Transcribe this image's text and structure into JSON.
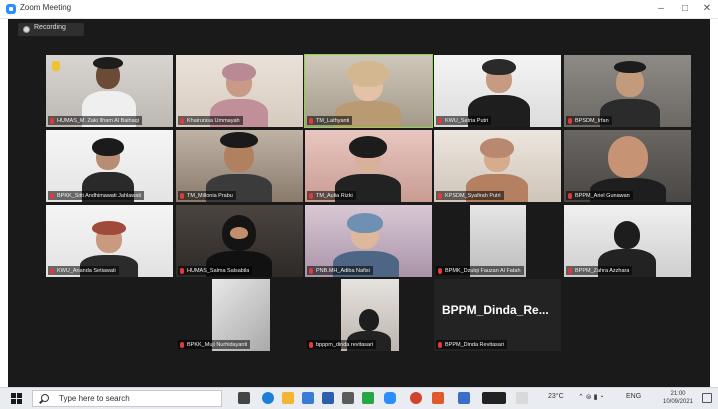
{
  "window": {
    "title": "Zoom Meeting",
    "controls": [
      "–",
      "□",
      "✕"
    ]
  },
  "recording": {
    "label": "Recording"
  },
  "tiles": [
    {
      "name": "HUMAS_M. Zaki Ilham Al Baihaqi",
      "active": false
    },
    {
      "name": "Khairunisa Ummayah",
      "active": false
    },
    {
      "name": "TM_Lathyanti",
      "active": true
    },
    {
      "name": "KWU_Satria Putri",
      "active": false
    },
    {
      "name": "BPSDM_Irfan",
      "active": false
    },
    {
      "name": "BPKK_Sitti Andhimawati Jahlawati",
      "active": false
    },
    {
      "name": "TM_Millonia Prabu",
      "active": false
    },
    {
      "name": "TM_Aulia Rizki",
      "active": false
    },
    {
      "name": "KPSDM_Syafirah Putri",
      "active": false
    },
    {
      "name": "BPPM_Ariel Gunawan",
      "active": false
    },
    {
      "name": "KWU_Ananda Setiawati",
      "active": false
    },
    {
      "name": "HUMAS_Salma Salsabila",
      "active": false
    },
    {
      "name": "PNB.MH_Adiba Nafisi",
      "active": false
    },
    {
      "name": "BPMK_Dzulqi Fauzan Al Fatah",
      "active": false
    },
    {
      "name": "BPPM_Zahra Azzhara",
      "active": false
    },
    {
      "name": "BPKK_Muji Nurhidayanti",
      "active": false
    },
    {
      "name": "bpppm_dinda revitasari",
      "active": false
    },
    {
      "name": "BPPM_Dinda Revitasari",
      "active": false,
      "display_text": "BPPM_Dinda_Re..."
    }
  ],
  "taskbar": {
    "search_placeholder": "Type here to search",
    "tray_temp": "23°C",
    "tray_lang": "ENG",
    "time": "21:00",
    "date": "10/09/2021"
  },
  "colors": {
    "active_border": "#8ad34a",
    "zoom_blue": "#2d8cff",
    "muted_mic": "#e0393e"
  }
}
